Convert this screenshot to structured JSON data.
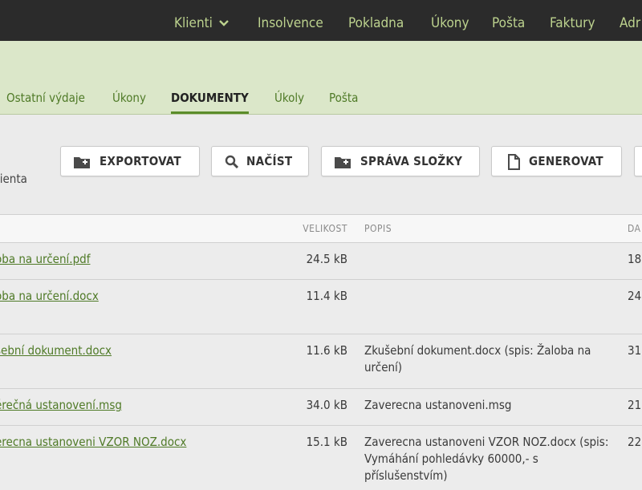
{
  "topnav": {
    "items": [
      "Klienti",
      "Insolvence",
      "Pokladna",
      "Úkony",
      "Pošta",
      "Faktury",
      "Adr"
    ]
  },
  "tabs": {
    "items": [
      "Ostatní výdaje",
      "Úkony",
      "DOKUMENTY",
      "Úkoly",
      "Pošta"
    ],
    "active": "DOKUMENTY"
  },
  "toolbar": {
    "label": "lienta",
    "buttons": [
      "EXPORTOVAT",
      "NAČÍST",
      "SPRÁVA SLOŽKY",
      "GENEROVAT"
    ]
  },
  "table": {
    "headers": {
      "size": "VELIKOST",
      "desc": "POPIS",
      "date": "DA"
    },
    "rows": [
      {
        "name": "oba na určení.pdf",
        "size": "24.5 kB",
        "desc": "",
        "date": "18"
      },
      {
        "name": "oba na určení.docx",
        "size": "11.4 kB",
        "desc": "",
        "date": "24"
      },
      {
        "name": "šební dokument.docx",
        "size": "11.6 kB",
        "desc": "Zkušební dokument.docx (spis: Žaloba na určení)",
        "date": "31"
      },
      {
        "name": "ěrečná ustanovení.msg",
        "size": "34.0 kB",
        "desc": "Zaverecna ustanoveni.msg",
        "date": "21"
      },
      {
        "name": "erecna ustanoveni VZOR NOZ.docx",
        "size": "15.1 kB",
        "desc": "Zaverecna ustanoveni VZOR NOZ.docx (spis: Vymáhání pohledávky 60000,- s příslušenstvím)",
        "date": "22"
      }
    ]
  },
  "colors": {
    "nav_bg": "#2b2b2b",
    "nav_text": "#bcd28e",
    "accent": "#5b8c2a",
    "band": "#dbe7c9"
  }
}
